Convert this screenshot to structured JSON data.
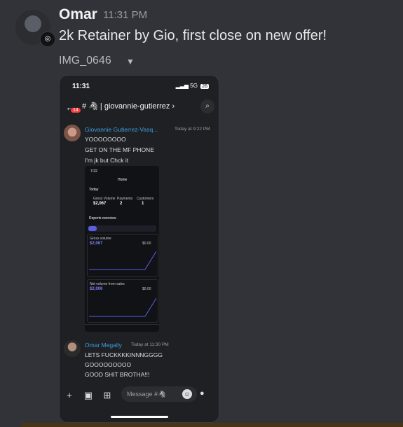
{
  "message": {
    "author": "Omar",
    "timestamp": "11:31 PM",
    "text": "2k Retainer by Gio, first close on new offer!",
    "attachment_name": "IMG_0646",
    "avatar_badge_icon": "discord-icon"
  },
  "phone": {
    "status_time": "11:31",
    "network": "5G",
    "battery": "26",
    "unread_badge": "14",
    "channel_name": "# 🦓 | giovannie-gutierrez",
    "messages": [
      {
        "author": "Giovannie Gutierrez-Vasq...",
        "time": "Today at 9:22 PM",
        "lines": [
          "YOOOOOOOO",
          "GET ON THE MF PHONE",
          "I'm jk but Chck it"
        ]
      },
      {
        "author": "Omar Megally",
        "time": "Today at 11:30 PM",
        "lines": [
          "LETS FUCKKKKINNNGGGG",
          "GOOOOOOOOO",
          "GOOD SHIT BROTHA!!!"
        ]
      }
    ],
    "composer_placeholder": "Message #🦓"
  },
  "embedded_screenshot": {
    "time": "7:22",
    "title": "Home",
    "today_label": "Today",
    "gross_volume_label": "Gross Volume",
    "gross_volume": "$2,067",
    "payments_label": "Payments",
    "payments": "2",
    "customers_label": "Customers",
    "customers": "1",
    "reports_label": "Reports overview",
    "chart1_label": "Gross volume",
    "chart1_value": "$2,067",
    "chart1_right": "$0.00",
    "chart2_label": "Net volume from sales",
    "chart2_value": "$2,006",
    "chart2_right": "$0.00"
  },
  "colors": {
    "background": "#323339",
    "accent": "#3a9fe0",
    "badge": "#f23f42"
  }
}
